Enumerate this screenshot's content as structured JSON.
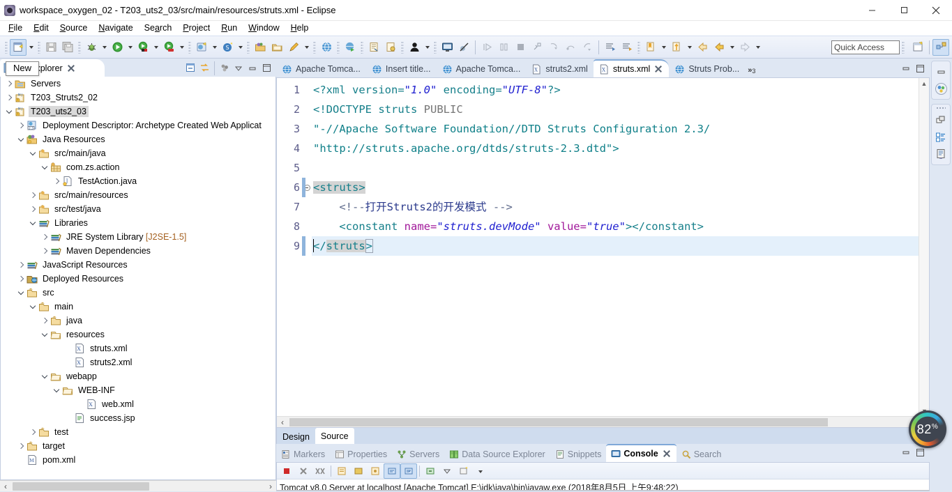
{
  "window": {
    "title": "workspace_oxygen_02 - T203_uts2_03/src/main/resources/struts.xml - Eclipse",
    "app_icon": "eclipse-icon",
    "minimize_label": "Minimize",
    "maximize_label": "Maximize",
    "close_label": "Close"
  },
  "menubar": {
    "items": [
      {
        "label": "File",
        "mnemonic": "F"
      },
      {
        "label": "Edit",
        "mnemonic": "E"
      },
      {
        "label": "Source",
        "mnemonic": "S"
      },
      {
        "label": "Navigate",
        "mnemonic": "N"
      },
      {
        "label": "Search",
        "mnemonic": "a"
      },
      {
        "label": "Project",
        "mnemonic": "P"
      },
      {
        "label": "Run",
        "mnemonic": "R"
      },
      {
        "label": "Window",
        "mnemonic": "W"
      },
      {
        "label": "Help",
        "mnemonic": "H"
      }
    ]
  },
  "toolbar": {
    "quick_access_placeholder": "Quick Access",
    "buttons": [
      {
        "name": "new-wizard-button",
        "icon": "new-file-icon",
        "active": true
      },
      {
        "name": "new-wizard-dropdown",
        "icon": "chevron-down-icon"
      },
      {
        "name": "save-button",
        "icon": "save-icon"
      },
      {
        "name": "save-all-button",
        "icon": "save-all-icon"
      },
      {
        "name": "debug-button",
        "icon": "bug-icon"
      },
      {
        "name": "debug-dropdown",
        "icon": "chevron-down-icon"
      },
      {
        "name": "run-button",
        "icon": "run-green-play-icon"
      },
      {
        "name": "run-dropdown",
        "icon": "chevron-down-icon"
      },
      {
        "name": "run-as-server-button",
        "icon": "run-server-icon"
      },
      {
        "name": "run-as-server-dropdown",
        "icon": "chevron-down-icon"
      },
      {
        "name": "run-coverage-button",
        "icon": "coverage-icon"
      },
      {
        "name": "run-coverage-dropdown",
        "icon": "chevron-down-icon"
      },
      {
        "name": "new-server-button",
        "icon": "new-server-icon"
      },
      {
        "name": "new-server-dropdown",
        "icon": "chevron-down-icon"
      },
      {
        "name": "new-sql-button",
        "icon": "sql-scrapbook-icon"
      },
      {
        "name": "new-sql-dropdown",
        "icon": "chevron-down-icon"
      },
      {
        "name": "open-type-button",
        "icon": "open-folder-icon"
      },
      {
        "name": "open-task-button",
        "icon": "open-folder-alt-icon"
      },
      {
        "name": "pencil-button",
        "icon": "pencil-icon"
      },
      {
        "name": "pencil-dropdown",
        "icon": "chevron-down-icon"
      },
      {
        "name": "web-browser-button",
        "icon": "globe-icon"
      },
      {
        "name": "web-browser-2-button",
        "icon": "globe-run-icon"
      },
      {
        "name": "open-declaration-button",
        "icon": "doc-search-icon"
      },
      {
        "name": "annotation-button",
        "icon": "annotation-icon"
      },
      {
        "name": "user-button",
        "icon": "user-icon"
      },
      {
        "name": "user-dropdown",
        "icon": "chevron-down-icon"
      },
      {
        "name": "terminal-button",
        "icon": "terminal-icon"
      },
      {
        "name": "skip-breakpoints-button",
        "icon": "skip-breakpoints-icon"
      },
      {
        "name": "resume-button",
        "icon": "resume-icon"
      },
      {
        "name": "suspend-button",
        "icon": "suspend-icon"
      },
      {
        "name": "terminate-button",
        "icon": "terminate-stop-icon"
      },
      {
        "name": "disconnect-button",
        "icon": "disconnect-icon"
      },
      {
        "name": "step-into-button",
        "icon": "step-into-icon"
      },
      {
        "name": "step-over-button",
        "icon": "step-over-icon"
      },
      {
        "name": "step-return-button",
        "icon": "step-return-icon"
      },
      {
        "name": "next-annotation-button",
        "icon": "next-annotation-icon"
      },
      {
        "name": "previous-annotation-button",
        "icon": "previous-annotation-icon"
      },
      {
        "name": "last-edit-button",
        "icon": "last-edit-location-icon"
      },
      {
        "name": "last-edit-dropdown",
        "icon": "chevron-down-icon"
      },
      {
        "name": "forward-history-button",
        "icon": "forward-nav-icon"
      },
      {
        "name": "forward-dropdown",
        "icon": "chevron-down-icon"
      },
      {
        "name": "back-button",
        "icon": "back-arrow-icon"
      },
      {
        "name": "back-yellow-button",
        "icon": "back-arrow-yellow-icon"
      },
      {
        "name": "back-dropdown",
        "icon": "chevron-down-icon"
      },
      {
        "name": "next-button",
        "icon": "forward-arrow-icon"
      },
      {
        "name": "next-dropdown",
        "icon": "chevron-down-icon"
      }
    ],
    "perspective_buttons": [
      {
        "name": "open-perspective-button",
        "icon": "open-perspective-icon"
      },
      {
        "name": "java-ee-perspective-button",
        "icon": "java-ee-perspective-icon",
        "active": true
      }
    ]
  },
  "project_explorer": {
    "tab_label": "ect Explorer",
    "tab_icon": "project-explorer-icon",
    "tooltip": "New",
    "view_tools": [
      {
        "name": "collapse-all-button",
        "icon": "collapse-all-icon"
      },
      {
        "name": "link-with-editor-button",
        "icon": "link-editor-icon"
      },
      {
        "name": "view-menu-button",
        "icon": "view-menu-icon"
      },
      {
        "name": "minimize-view-button",
        "icon": "minimize-icon"
      },
      {
        "name": "maximize-view-button",
        "icon": "maximize-icon"
      }
    ],
    "tree": [
      {
        "label": "Servers",
        "indent": 1,
        "twist": "collapsed",
        "icon": "folder-servers-icon",
        "selected": false
      },
      {
        "label": "T203_Struts2_02",
        "indent": 1,
        "twist": "collapsed",
        "icon": "maven-project-icon",
        "selected": false
      },
      {
        "label": "T203_uts2_03",
        "indent": 1,
        "twist": "expanded",
        "icon": "maven-project-icon",
        "selected": true
      },
      {
        "label": "Deployment Descriptor: Archetype Created Web Applicat",
        "indent": 2,
        "twist": "collapsed",
        "icon": "deployment-descriptor-icon",
        "selected": false
      },
      {
        "label": "Java Resources",
        "indent": 2,
        "twist": "expanded",
        "icon": "java-resources-icon",
        "selected": false
      },
      {
        "label": "src/main/java",
        "indent": 3,
        "twist": "expanded",
        "icon": "source-folder-icon",
        "selected": false
      },
      {
        "label": "com.zs.action",
        "indent": 4,
        "twist": "expanded",
        "icon": "package-icon",
        "selected": false
      },
      {
        "label": "TestAction.java",
        "indent": 5,
        "twist": "collapsed",
        "icon": "java-file-icon",
        "selected": false
      },
      {
        "label": "src/main/resources",
        "indent": 3,
        "twist": "collapsed",
        "icon": "source-folder-icon",
        "selected": false
      },
      {
        "label": "src/test/java",
        "indent": 3,
        "twist": "collapsed",
        "icon": "source-folder-icon",
        "selected": false
      },
      {
        "label": "Libraries",
        "indent": 3,
        "twist": "expanded",
        "icon": "library-icon",
        "selected": false
      },
      {
        "label": "JRE System Library",
        "suffix": "[J2SE-1.5]",
        "indent": 4,
        "twist": "collapsed",
        "icon": "library-icon",
        "selected": false
      },
      {
        "label": "Maven Dependencies",
        "indent": 4,
        "twist": "collapsed",
        "icon": "library-icon",
        "selected": false
      },
      {
        "label": "JavaScript Resources",
        "indent": 2,
        "twist": "collapsed",
        "icon": "library-icon",
        "selected": false
      },
      {
        "label": "Deployed Resources",
        "indent": 2,
        "twist": "collapsed",
        "icon": "deployed-resources-icon",
        "selected": false
      },
      {
        "label": "src",
        "indent": 2,
        "twist": "expanded",
        "icon": "folder-icon",
        "selected": false
      },
      {
        "label": "main",
        "indent": 3,
        "twist": "expanded",
        "icon": "folder-icon",
        "selected": false
      },
      {
        "label": "java",
        "indent": 4,
        "twist": "collapsed",
        "icon": "folder-icon",
        "selected": false
      },
      {
        "label": "resources",
        "indent": 4,
        "twist": "expanded",
        "icon": "folder-open-icon",
        "selected": false
      },
      {
        "label": "struts.xml",
        "indent": 6,
        "twist": "none",
        "icon": "xml-file-icon",
        "selected": false
      },
      {
        "label": "struts2.xml",
        "indent": 6,
        "twist": "none",
        "icon": "xml-file-icon",
        "selected": false
      },
      {
        "label": "webapp",
        "indent": 4,
        "twist": "expanded",
        "icon": "folder-open-icon",
        "selected": false
      },
      {
        "label": "WEB-INF",
        "indent": 5,
        "twist": "expanded",
        "icon": "folder-open-icon",
        "selected": false
      },
      {
        "label": "web.xml",
        "indent": 7,
        "twist": "none",
        "icon": "xml-file-icon",
        "selected": false
      },
      {
        "label": "success.jsp",
        "indent": 6,
        "twist": "none",
        "icon": "jsp-file-icon",
        "selected": false
      },
      {
        "label": "test",
        "indent": 3,
        "twist": "collapsed",
        "icon": "folder-icon",
        "selected": false
      },
      {
        "label": "target",
        "indent": 2,
        "twist": "collapsed",
        "icon": "folder-icon",
        "selected": false
      },
      {
        "label": "pom.xml",
        "indent": 2,
        "twist": "none",
        "icon": "maven-pom-icon",
        "selected": false
      }
    ]
  },
  "editor": {
    "tabs": [
      {
        "label": "Apache Tomca...",
        "icon": "globe-icon",
        "active": false
      },
      {
        "label": "Insert title...",
        "icon": "globe-icon",
        "active": false
      },
      {
        "label": "Apache Tomca...",
        "icon": "globe-icon",
        "active": false
      },
      {
        "label": "struts2.xml",
        "icon": "xml-file-icon",
        "active": false
      },
      {
        "label": "struts.xml",
        "icon": "xml-file-icon",
        "active": true
      },
      {
        "label": "Struts Prob...",
        "icon": "globe-icon",
        "active": false
      }
    ],
    "overflow_label": "»",
    "overflow_count": "3",
    "view_tools": [
      {
        "name": "minimize-editor-button",
        "icon": "minimize-icon"
      },
      {
        "name": "maximize-editor-button",
        "icon": "maximize-icon"
      }
    ],
    "line_numbers": [
      "1",
      "2",
      "3",
      "4",
      "5",
      "6",
      "7",
      "8",
      "9"
    ],
    "current_line": 9,
    "fold_marker_line": 6,
    "code": {
      "line1": {
        "prefix": "<?xml version=",
        "v1": "\"1.0\"",
        "mid": " encoding=",
        "v2": "\"UTF-8\"",
        "suffix": "?>"
      },
      "line2": {
        "open": "<!DOCTYPE ",
        "name": "struts",
        "kw": " PUBLIC"
      },
      "line3": "    \"-//Apache Software Foundation//DTD Struts Configuration 2.3/",
      "line4": "    \"http://struts.apache.org/dtds/struts-2.3.dtd\">",
      "line5": "",
      "line6": "<struts>",
      "line7": {
        "open": "<!--",
        "cn": "打开Struts2的开发模式",
        "close": " -->"
      },
      "line8": {
        "tag_open": "<constant ",
        "attr": "name=",
        "val": "\"struts.devMode\"",
        "attr2": " value=",
        "val2": "\"true\"",
        "tag_close": "></constant>"
      },
      "line9": "</struts>"
    },
    "bottom_tabs": [
      {
        "label": "Design",
        "active": false
      },
      {
        "label": "Source",
        "active": true
      }
    ]
  },
  "console": {
    "tabs": [
      {
        "label": "Markers",
        "icon": "markers-icon",
        "active": false
      },
      {
        "label": "Properties",
        "icon": "properties-icon",
        "active": false
      },
      {
        "label": "Servers",
        "icon": "servers-icon",
        "active": false
      },
      {
        "label": "Data Source Explorer",
        "icon": "data-source-icon",
        "active": false
      },
      {
        "label": "Snippets",
        "icon": "snippets-icon",
        "active": false
      },
      {
        "label": "Console",
        "icon": "console-icon",
        "active": true
      },
      {
        "label": "Search",
        "icon": "search-icon",
        "active": false
      }
    ],
    "view_tools": [
      {
        "name": "minimize-console-button",
        "icon": "minimize-icon"
      },
      {
        "name": "maximize-console-button",
        "icon": "maximize-icon"
      }
    ],
    "toolbar": [
      {
        "name": "terminate-button",
        "icon": "terminate-stop-icon"
      },
      {
        "name": "remove-launch-button",
        "icon": "remove-x-icon"
      },
      {
        "name": "remove-all-launches-button",
        "icon": "remove-all-xx-icon"
      },
      {
        "name": "open-console-button",
        "icon": "open-console-icon"
      },
      {
        "name": "display-selected-console-button",
        "icon": "display-console-icon"
      },
      {
        "name": "pin-console-button",
        "icon": "pin-console-icon"
      },
      {
        "name": "scroll-lock-button",
        "icon": "scroll-lock-icon",
        "on": true
      },
      {
        "name": "word-wrap-button",
        "icon": "word-wrap-icon",
        "on": true
      },
      {
        "name": "show-console-when-output-button",
        "icon": "show-on-output-icon"
      },
      {
        "name": "pin-button",
        "icon": "pin-icon"
      },
      {
        "name": "new-console-view-button",
        "icon": "new-console-view-icon"
      },
      {
        "name": "console-dropdown",
        "icon": "chevron-down-icon"
      }
    ],
    "output_line": "Tomcat v8.0 Server at localhost [Apache Tomcat] E:\\jdk\\java\\bin\\javaw.exe (2018年8月5日 上午9:48:22)"
  },
  "right_edge": {
    "groups": [
      {
        "buttons": [
          {
            "name": "restore-view-button",
            "icon": "restore-icon"
          },
          {
            "name": "servers-fast-view-button",
            "icon": "servers-palette-icon"
          }
        ]
      },
      {
        "buttons": [
          {
            "name": "palette-fast-view-button",
            "icon": "palette-stack-icon"
          },
          {
            "name": "outline-fast-view-button",
            "icon": "outline-icon"
          },
          {
            "name": "properties-fast-view-button",
            "icon": "properties-doc-icon"
          }
        ]
      }
    ]
  },
  "zoom_badge": {
    "value": "82",
    "unit": "%"
  },
  "colors": {
    "accent": "#3aa8e0",
    "tag": "#157f8a",
    "attribute": "#a1189a",
    "value": "#2020d0",
    "comment": "#5f6b8c",
    "current_line": "#e4f0fb",
    "toolbar_bg": "#e4eaf6",
    "panel_bg": "#dfe7f3"
  }
}
